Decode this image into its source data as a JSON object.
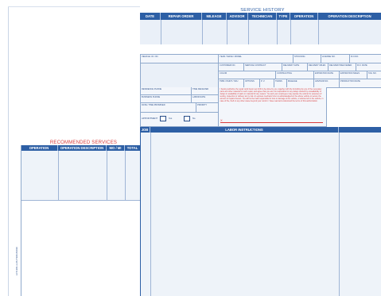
{
  "service_history": {
    "title": "SERVICE HISTORY",
    "columns": [
      "DATE",
      "REPAIR ORDER",
      "MILEAGE",
      "ADVISOR",
      "TECHNICIAN",
      "TYPE",
      "OPERATION",
      "OPERATION DESCRIPTION"
    ]
  },
  "vehicle_info": {
    "vin_label": "VEHICLE I.D. NO.",
    "year_make_model": "YEAR / MAKE / MODEL",
    "stocking": "STOCKING",
    "license": "LICENSE NO.",
    "ro_no": "R.O.NO.",
    "customer_no": "CUSTOMER NO.",
    "service_contract": "SERVICE CONTRACT",
    "delivery_date": "DELIVERY DATE",
    "delivery_miles": "DELIVERY MILES",
    "delivery_miles_2": "DELIVERY/DELIVERED",
    "ro_date": "R.O. DATE",
    "color": "COLOR",
    "contracting": "CONTRACTING",
    "expiration_date": "EXPIRATION DATE",
    "expiration_miles": "EXPIRATION MILES",
    "tag_no": "TAG NO.",
    "trim": "TRIM / PAINT / SKU",
    "options": "OPTIONS",
    "pv": "P. V.",
    "trans": "TRANS",
    "mileage": "MILEAGE",
    "advisor_no": "ADVISOR NO.",
    "production_date": "PRODUCTION DATE"
  },
  "contact": {
    "residence_phone": "RESIDENCE PHONE",
    "time_received": "TIME RECEIVED",
    "business_phone": "BUSINESS PHONE",
    "labor_rate": "LABOR RATE",
    "date_time_promised": "DATE / TIME PROMISED",
    "priority": "PRIORITY",
    "appointment": "APPOINTMENT",
    "yes": "Yes",
    "no": "No"
  },
  "authorization_text": "I hereby authorize the repair work herein set forth to be done by you, together with the furnishing by you of the necessary parts and other material for such repair, and agree that you are not responsible for any delays caused by unavailability or delays in availability of parts or material for any reason. You and your employees may operate the vehicle for purposes of testing, inspection or delivery at my risk. An express mechanic's lien is acknowledged on the above vehicle to secure the amount of repairs thereto. You will not be held responsible for loss or damage to the vehicle, or articles left in the vehicle, in case of fire, theft or any other cause beyond your control. I have read and understood the terms of this authorization.",
  "signature_mark": "X",
  "recommended": {
    "title": "RECOMMENDED SERVICES",
    "columns": [
      "OPERATION",
      "OPERATION DESCRIPTION",
      "MO / MI",
      "TOTAL"
    ]
  },
  "labor": {
    "job_label": "JOB",
    "title": "LABOR INSTRUCTIONS"
  },
  "side_code": "LCS 901-LHS   ITEM #1099"
}
